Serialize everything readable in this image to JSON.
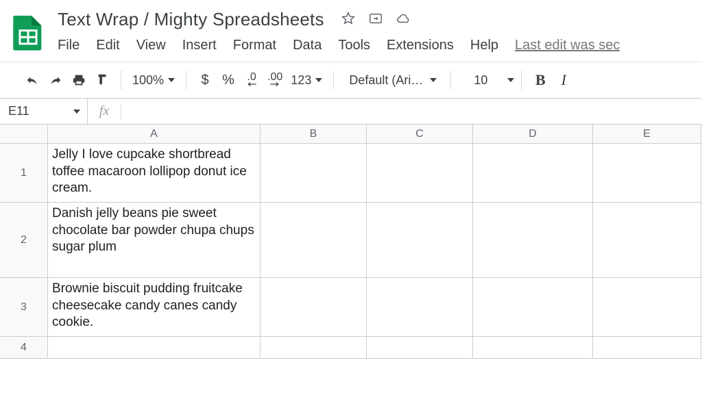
{
  "doc": {
    "title": "Text Wrap / Mighty Spreadsheets",
    "last_edit": "Last edit was sec"
  },
  "menu": {
    "file": "File",
    "edit": "Edit",
    "view": "View",
    "insert": "Insert",
    "format": "Format",
    "data": "Data",
    "tools": "Tools",
    "extensions": "Extensions",
    "help": "Help"
  },
  "toolbar": {
    "zoom": "100%",
    "currency": "$",
    "percent": "%",
    "dec_dec": ".0",
    "inc_dec": ".00",
    "more_formats": "123",
    "font_name": "Default (Ari…",
    "font_size": "10",
    "bold": "B",
    "italic": "I"
  },
  "fx": {
    "name_box": "E11",
    "fx_label": "fx",
    "formula": ""
  },
  "grid": {
    "columns": [
      "A",
      "B",
      "C",
      "D",
      "E"
    ],
    "rows": [
      {
        "n": "1",
        "A": "Jelly I love cupcake shortbread toffee macaroon lollipop donut ice cream."
      },
      {
        "n": "2",
        "A": "Danish jelly beans pie sweet chocolate bar powder chupa chups sugar plum"
      },
      {
        "n": "3",
        "A": "Brownie biscuit pudding fruitcake cheesecake candy canes candy cookie."
      },
      {
        "n": "4",
        "A": ""
      }
    ]
  }
}
